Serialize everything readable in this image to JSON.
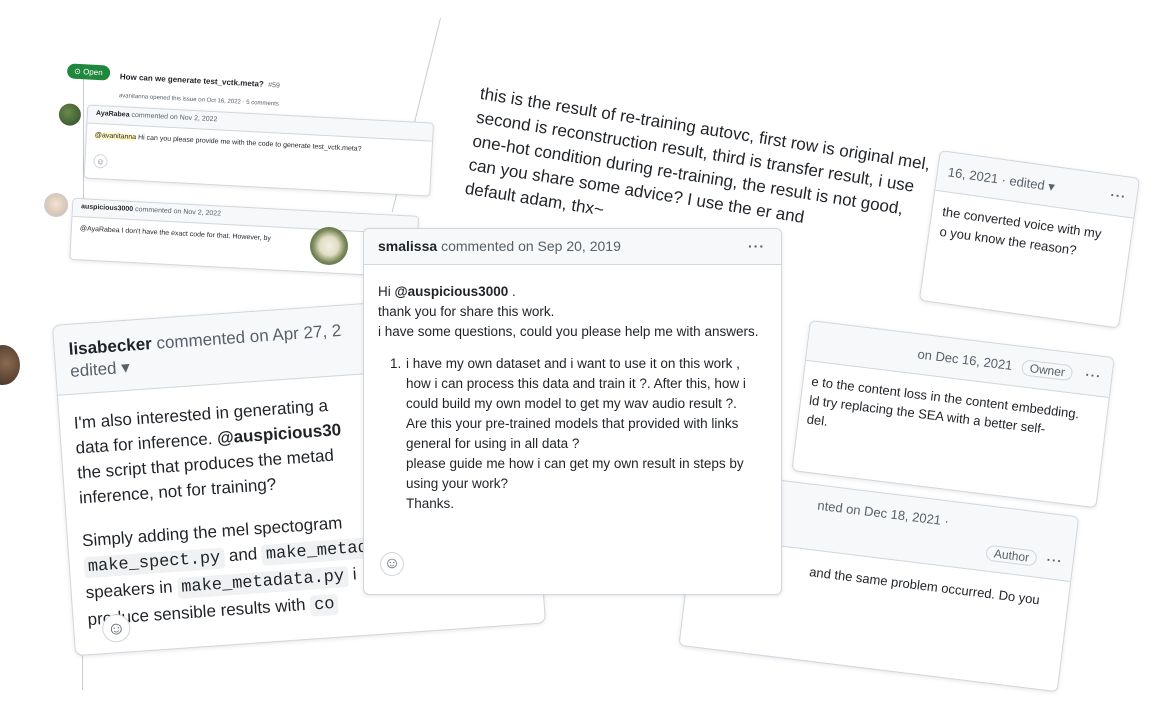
{
  "issue": {
    "status": "Open",
    "title": "How can we generate test_vctk.meta?",
    "number": "#59",
    "meta": "avanitanna opened this issue on Oct 16, 2022 · 5 comments"
  },
  "comments": {
    "ayal": {
      "user": "AyaRabea",
      "action": "commented on Nov 2, 2022",
      "mention": "@avanitanna",
      "body": " Hi can you please provide me with the code to generate test_vctk.meta?"
    },
    "ausp": {
      "user": "auspicious3000",
      "action": "commented on Nov 2, 2022",
      "mention": "@AyaRabea",
      "body": " I don't have the exact code for that. However, by"
    },
    "retrain": {
      "lines": [
        "this is the result of re-training autovc, first row is original mel,",
        "second is reconstruction result, third is transfer result, i use",
        "one-hot condition during re-training, the result is not good,",
        "can you share some advice? I use the                                   er and",
        "default adam, thx~"
      ]
    },
    "right_top": {
      "header": "16, 2021 · edited",
      "lines": [
        "the converted voice with my",
        "o you know the reason?"
      ]
    },
    "right_mid": {
      "header": "on Dec 16, 2021",
      "badge": "Owner",
      "lines": [
        "e to the content loss in the content embedding.",
        "ld try replacing the SEA with a better self-",
        "del."
      ]
    },
    "right_bot": {
      "header": "nted on Dec 18, 2021 ·",
      "badge": "Author",
      "lines": [
        "and the same problem occurred. Do you"
      ]
    },
    "lisa": {
      "user": "lisabecker",
      "action": "commented on Apr 27, 2",
      "edited": "edited",
      "p1": [
        "I'm also interested in generating a",
        "data for inference. ",
        "the script that produces the metad",
        "inference, not for training?"
      ],
      "p1_mention": "@auspicious30",
      "p2_line1": "Simply adding the mel spectogram",
      "p2_code1": "make_spect.py",
      "p2_and": " and ",
      "p2_code2": "make_metada",
      "p2_line3a": "speakers in ",
      "p2_code3": "make_metadata.py",
      "p2_line3b": " i",
      "p2_line4a": "produce sensible results with ",
      "p2_code4": "co"
    },
    "smalissa": {
      "user": "smalissa",
      "action": "commented on Sep 20, 2019",
      "greeting": "Hi ",
      "mention": "@auspicious3000",
      "greeting_end": " .",
      "line2": "thank you for share this work.",
      "line3": "i have some questions, could you please help me with answers.",
      "list_number": "1.",
      "list_text": "i have my own dataset and i want to use it on this work , how i can process this data and train it ?. After this, how i could build my own model to get my wav audio result ?.",
      "extra1": "Are this your pre-trained models that provided with links general for using in all data ?",
      "extra2": "please guide me how i can get my own result in steps by using your work?",
      "extra3": "Thanks."
    }
  },
  "icons": {
    "kebab": "···",
    "caret": "▾",
    "smiley": "☺",
    "open": "⊙"
  },
  "colors": {
    "open_green": "#1f883d",
    "header_bg": "#f6f8fa",
    "border": "#d0d7de"
  }
}
